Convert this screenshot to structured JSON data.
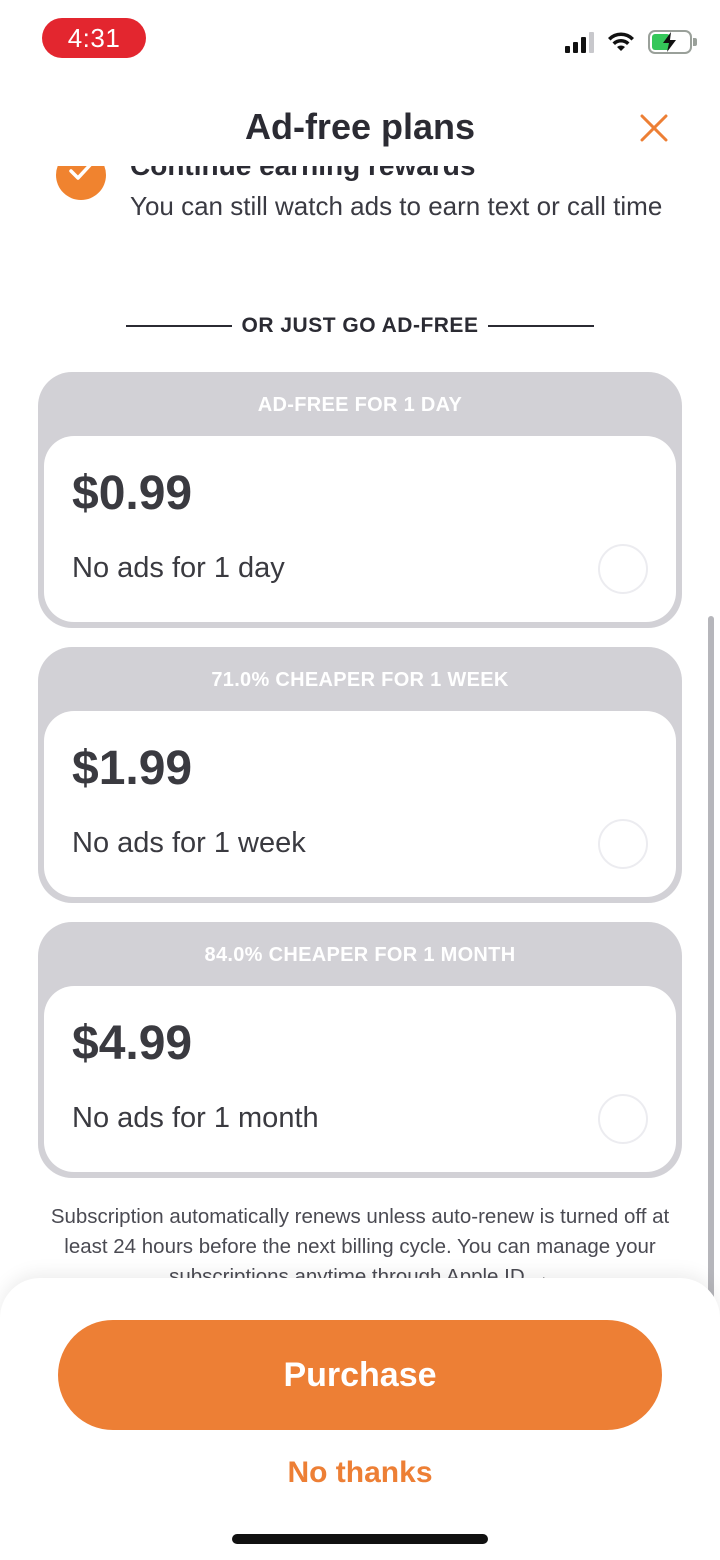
{
  "status_bar": {
    "time": "4:31"
  },
  "header": {
    "title": "Ad-free plans"
  },
  "reward": {
    "title": "Continue earning rewards",
    "description": "You can still watch ads to earn text or call time"
  },
  "divider": {
    "label": "OR JUST GO AD-FREE"
  },
  "plans": [
    {
      "band": "AD-FREE FOR 1 DAY",
      "price": "$0.99",
      "subtitle": "No ads for 1 day",
      "selected": false
    },
    {
      "band": "71.0% CHEAPER FOR 1 WEEK",
      "price": "$1.99",
      "subtitle": "No ads for 1 week",
      "selected": false
    },
    {
      "band": "84.0% CHEAPER FOR 1 MONTH",
      "price": "$4.99",
      "subtitle": "No ads for 1 month",
      "selected": false
    }
  ],
  "fineprint": "Subscription automatically renews unless auto-renew is turned off at least 24 hours before the next billing cycle. You can manage your subscriptions anytime through Apple ID →",
  "actions": {
    "purchase_label": "Purchase",
    "no_thanks_label": "No thanks"
  },
  "colors": {
    "accent": "#ed7f35",
    "time_pill": "#e3262f",
    "plan_band": "#d2d1d6"
  },
  "icons": {
    "close": "close-icon",
    "check": "check-icon",
    "signal": "cellular-signal-icon",
    "wifi": "wifi-icon",
    "battery": "battery-charging-icon"
  }
}
